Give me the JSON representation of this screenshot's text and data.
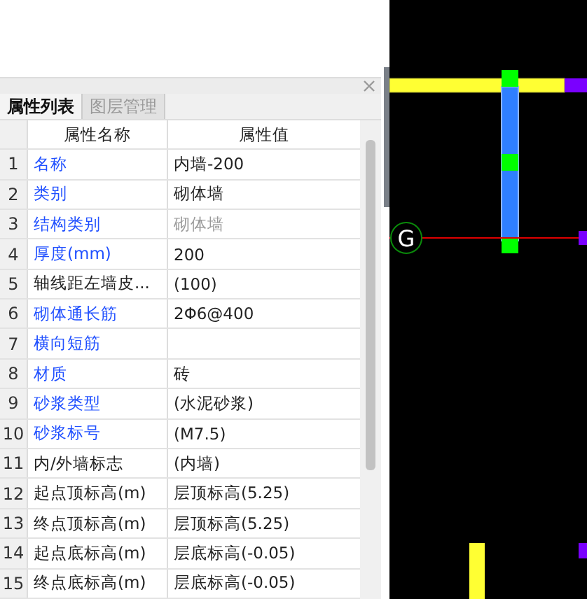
{
  "panel": {
    "tabs": [
      {
        "label": "属性列表",
        "selected": true
      },
      {
        "label": "图层管理",
        "selected": false
      }
    ],
    "columns": [
      "属性名称",
      "属性值"
    ],
    "rows": [
      {
        "index": "1",
        "name": "名称",
        "linked": true,
        "value": "内墙-200"
      },
      {
        "index": "2",
        "name": "类别",
        "linked": true,
        "value": "砌体墙"
      },
      {
        "index": "3",
        "name": "结构类别",
        "linked": true,
        "value": "砌体墙",
        "disabled": true
      },
      {
        "index": "4",
        "name": "厚度(mm)",
        "linked": true,
        "value": "200"
      },
      {
        "index": "5",
        "name": "轴线距左墙皮...",
        "linked": false,
        "value": "(100)"
      },
      {
        "index": "6",
        "name": "砌体通长筋",
        "linked": true,
        "value": "2Φ6@400"
      },
      {
        "index": "7",
        "name": "横向短筋",
        "linked": true
      },
      {
        "index": "8",
        "name": "材质",
        "linked": true,
        "value": "砖"
      },
      {
        "index": "9",
        "name": "砂浆类型",
        "linked": true,
        "value": "(水泥砂浆)"
      },
      {
        "index": "10",
        "name": "砂浆标号",
        "linked": true,
        "value": "(M7.5)"
      },
      {
        "index": "11",
        "name": "内/外墙标志",
        "linked": false,
        "value": "(内墙)"
      },
      {
        "index": "12",
        "name": "起点顶标高(m)",
        "linked": false,
        "value": "层顶标高(5.25)"
      },
      {
        "index": "13",
        "name": "终点顶标高(m)",
        "linked": false,
        "value": "层顶标高(5.25)"
      },
      {
        "index": "14",
        "name": "起点底标高(m)",
        "linked": false,
        "value": "层底标高(-0.05)"
      },
      {
        "index": "15",
        "name": "终点底标高(m)",
        "linked": false,
        "value": "层底标高(-0.05)"
      }
    ]
  },
  "canvas": {
    "axis_label": "G"
  }
}
